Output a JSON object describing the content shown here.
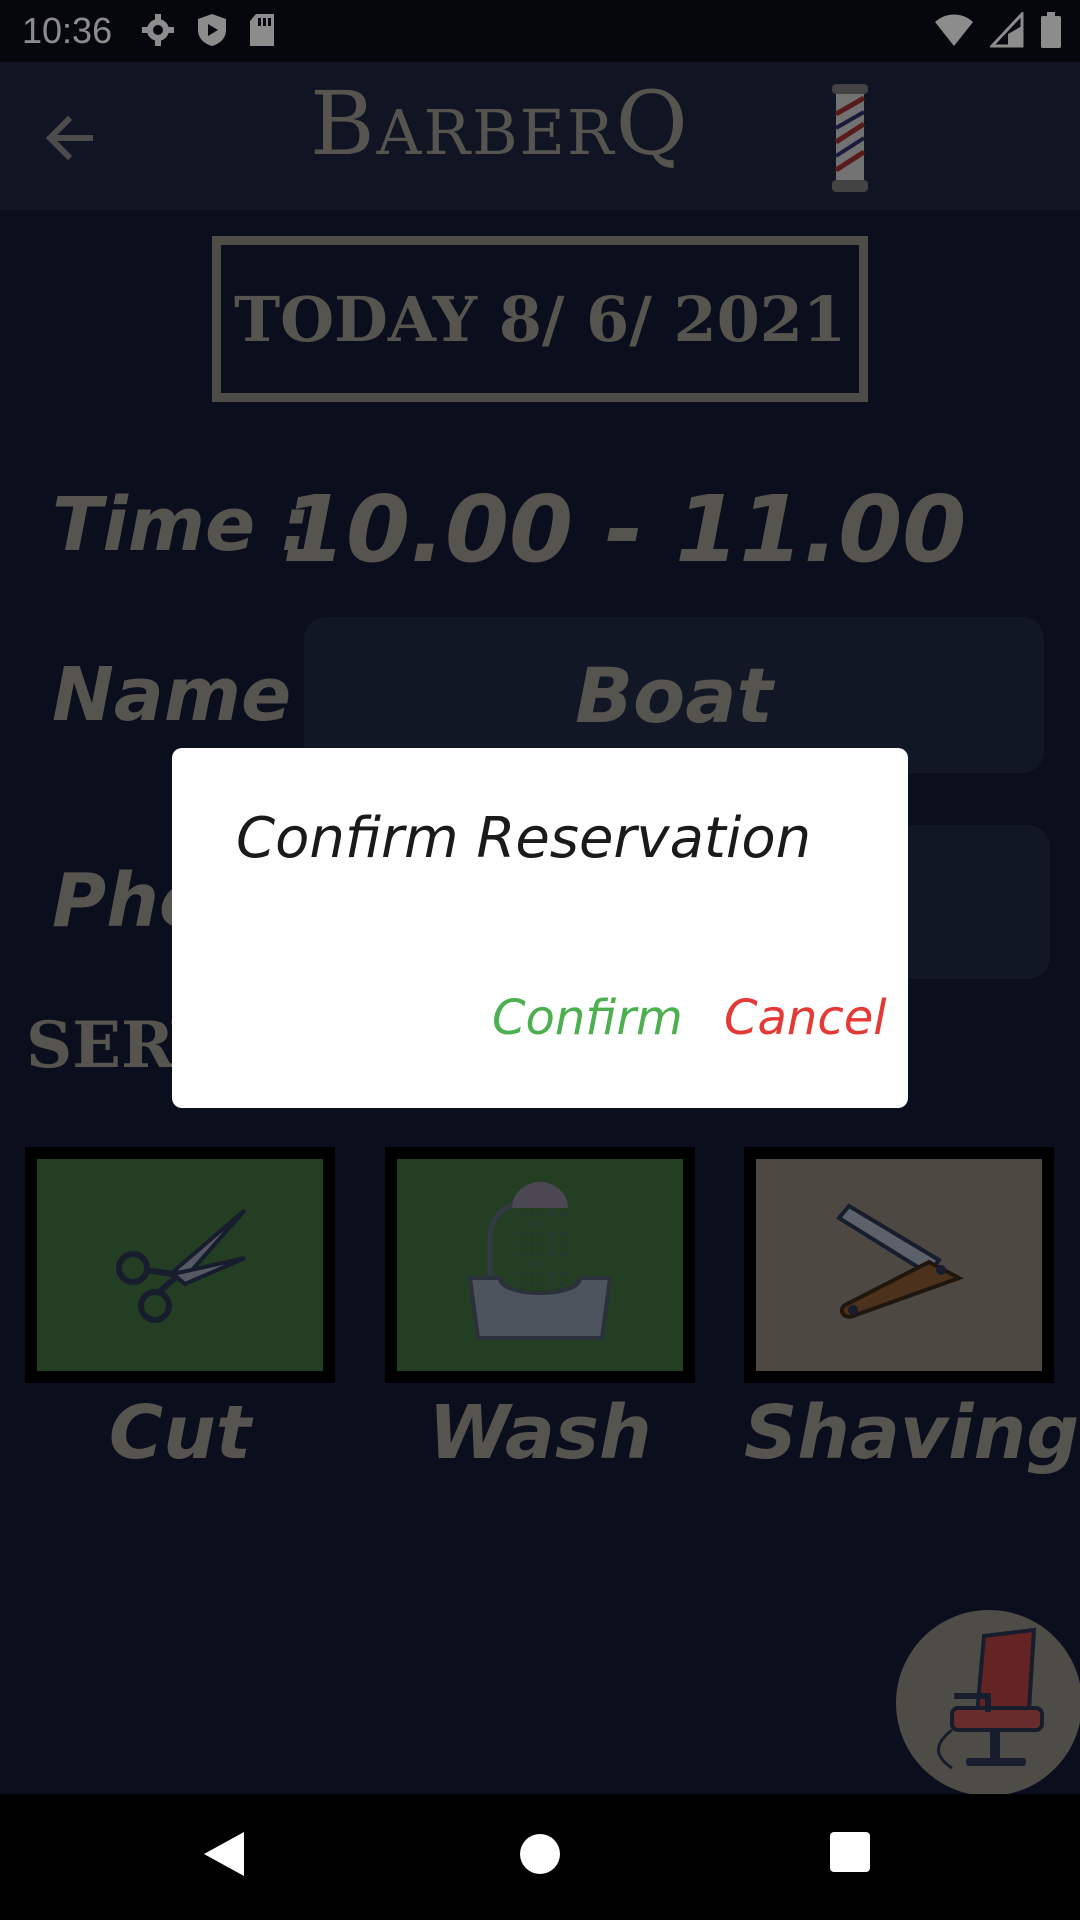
{
  "status_bar": {
    "time": "10:36",
    "left_icons": [
      "settings-icon",
      "shield-icon",
      "sd-card-icon"
    ],
    "right_icons": [
      "wifi-icon",
      "signal-icon",
      "battery-icon"
    ]
  },
  "app_bar": {
    "back_icon": "arrow-back-icon",
    "logo_text": "BarberQ",
    "logo_icon": "barber-pole-icon"
  },
  "reservation": {
    "date_label": "TODAY 8/ 6/ 2021",
    "time_label": "Time :",
    "time_value": "10.00 - 11.00",
    "name_label": "Name :",
    "name_value": "Boat",
    "phone_label": "Pho",
    "services_label": "SERV"
  },
  "services": [
    {
      "label": "Cut",
      "icon": "scissors-icon",
      "bg": "#407140",
      "selected": true
    },
    {
      "label": "Wash",
      "icon": "hair-wash-icon",
      "bg": "#407140",
      "selected": true
    },
    {
      "label": "Shaving",
      "icon": "razor-icon",
      "bg": "#8d8679",
      "selected": false
    }
  ],
  "fab": {
    "icon": "barber-chair-icon"
  },
  "dialog": {
    "title": "Confirm Reservation",
    "confirm_label": "Confirm",
    "cancel_label": "Cancel",
    "confirm_color": "#4caf50",
    "cancel_color": "#e53935"
  },
  "nav_bar": {
    "icons": [
      "nav-back-icon",
      "nav-home-icon",
      "nav-recents-icon"
    ]
  },
  "colors": {
    "background": "#141b33",
    "app_bar": "#1e2540",
    "text_muted": "#9d9a90"
  }
}
